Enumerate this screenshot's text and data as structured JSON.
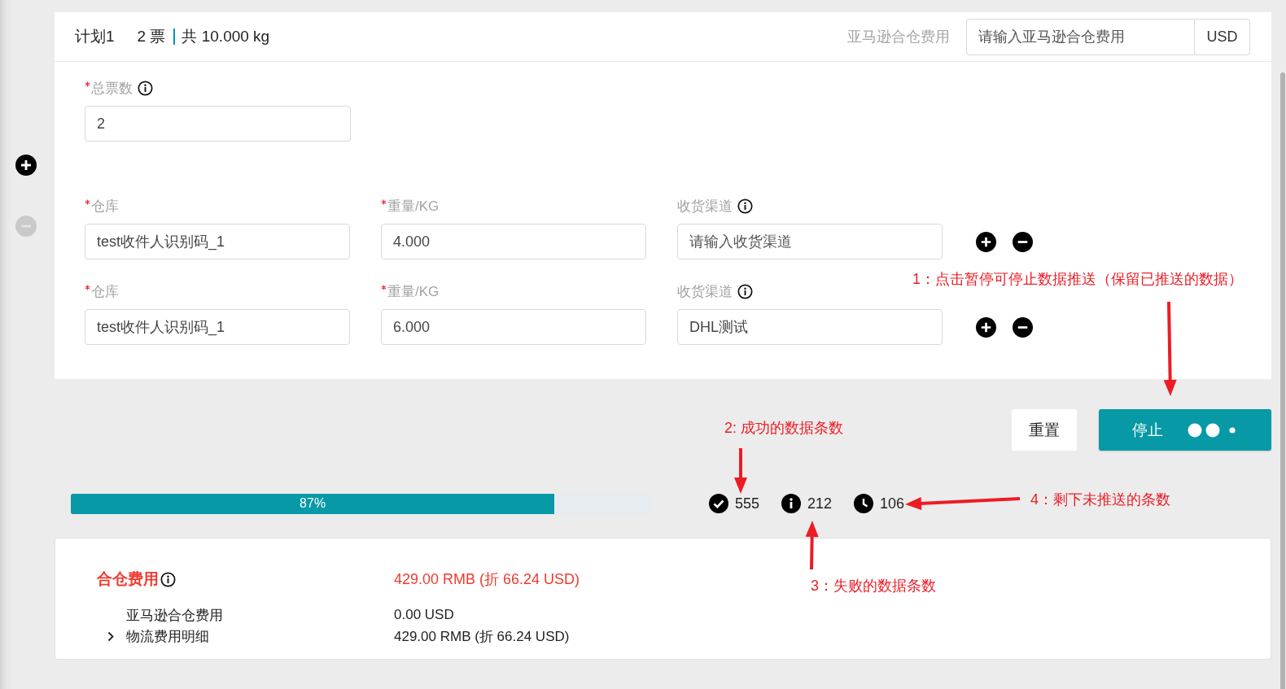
{
  "plan": {
    "title": "计划1",
    "tickets": "2 票",
    "total": "共 10.000 kg"
  },
  "amazon_fee": {
    "label": "亚马逊合仓费用",
    "placeholder": "请输入亚马逊合仓费用",
    "unit": "USD"
  },
  "side_controls": [
    {
      "kind": "add",
      "disabled": false
    },
    {
      "kind": "remove",
      "disabled": true
    }
  ],
  "total_tickets": {
    "label": "总票数",
    "required": true,
    "info": true,
    "value": "2"
  },
  "shipments": [
    {
      "fields": [
        {
          "label": "仓库",
          "required": true,
          "info": false,
          "value": "test收件人识别码_1"
        },
        {
          "label": "重量/KG",
          "required": true,
          "info": false,
          "value": "4.000"
        },
        {
          "label": "收货渠道",
          "required": false,
          "info": true,
          "placeholder": "请输入收货渠道"
        }
      ]
    },
    {
      "fields": [
        {
          "label": "仓库",
          "required": true,
          "info": false,
          "value": "test收件人识别码_1"
        },
        {
          "label": "重量/KG",
          "required": true,
          "info": false,
          "value": "6.000"
        },
        {
          "label": "收货渠道",
          "required": false,
          "info": true,
          "value": "DHL测试"
        }
      ]
    }
  ],
  "buttons": [
    {
      "label": "重置",
      "kind": "secondary",
      "loading": false
    },
    {
      "label": "停止",
      "kind": "primary",
      "loading": true
    }
  ],
  "progress": {
    "level": 0.83,
    "reading": "87%"
  },
  "stats": [
    {
      "kind": "success",
      "count": "555"
    },
    {
      "kind": "failed",
      "count": "212"
    },
    {
      "kind": "pending",
      "count": "106"
    }
  ],
  "fees": {
    "title": "合仓费用",
    "info": true,
    "total": "429.00 RMB (折 66.24 USD)",
    "items": [
      {
        "kind": "line",
        "label": "亚马逊合仓费用",
        "value": "0.00 USD"
      },
      {
        "kind": "group",
        "label": "物流费用明细",
        "value": "429.00 RMB (折 66.24 USD)",
        "expanded": false
      }
    ]
  },
  "annotations": [
    {
      "text": "1：点击暂停可停止数据推送（保留已推送的数据）"
    },
    {
      "text": "2: 成功的数据条数"
    },
    {
      "text": "3：失败的数据条数"
    },
    {
      "text": "4：剩下未推送的条数"
    }
  ]
}
